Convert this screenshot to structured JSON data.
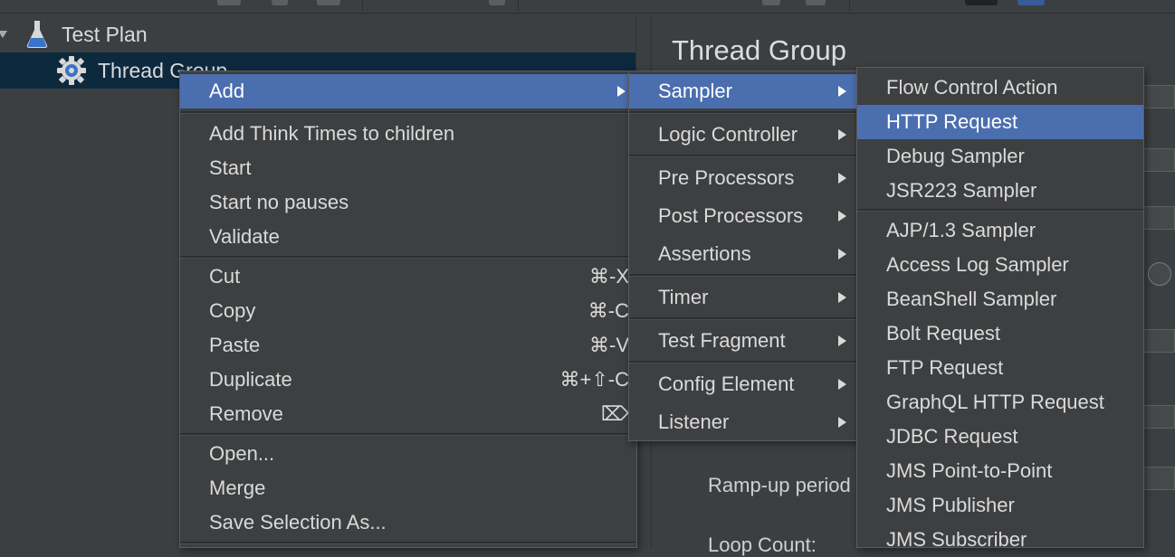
{
  "tree": {
    "test_plan_label": "Test Plan",
    "thread_group_label": "Thread Group"
  },
  "right_panel": {
    "title": "Thread Group",
    "ramp_up_label": "Ramp-up period",
    "loop_count_label": "Loop Count:"
  },
  "context_menu": {
    "add": "Add",
    "add_think_times": "Add Think Times to children",
    "start": "Start",
    "start_no_pauses": "Start no pauses",
    "validate": "Validate",
    "cut": "Cut",
    "cut_shortcut": "⌘-X",
    "copy": "Copy",
    "copy_shortcut": "⌘-C",
    "paste": "Paste",
    "paste_shortcut": "⌘-V",
    "duplicate": "Duplicate",
    "duplicate_shortcut": "⌘+⇧-C",
    "remove": "Remove",
    "remove_shortcut": "⌦",
    "open": "Open...",
    "merge": "Merge",
    "save_selection_as": "Save Selection As..."
  },
  "add_submenu": {
    "sampler": "Sampler",
    "logic_controller": "Logic Controller",
    "pre_processors": "Pre Processors",
    "post_processors": "Post Processors",
    "assertions": "Assertions",
    "timer": "Timer",
    "test_fragment": "Test Fragment",
    "config_element": "Config Element",
    "listener": "Listener"
  },
  "sampler_submenu": {
    "flow_control_action": "Flow Control Action",
    "http_request": "HTTP Request",
    "debug_sampler": "Debug Sampler",
    "jsr223_sampler": "JSR223 Sampler",
    "ajp_sampler": "AJP/1.3 Sampler",
    "access_log_sampler": "Access Log Sampler",
    "beanshell_sampler": "BeanShell Sampler",
    "bolt_request": "Bolt Request",
    "ftp_request": "FTP Request",
    "graphql_http_request": "GraphQL HTTP Request",
    "jdbc_request": "JDBC Request",
    "jms_point_to_point": "JMS Point-to-Point",
    "jms_publisher": "JMS Publisher",
    "jms_subscriber": "JMS Subscriber"
  },
  "colors": {
    "background": "#3c3f41",
    "highlight": "#4b6eaf",
    "tree_selection": "#0d293e",
    "text": "#dadada"
  }
}
